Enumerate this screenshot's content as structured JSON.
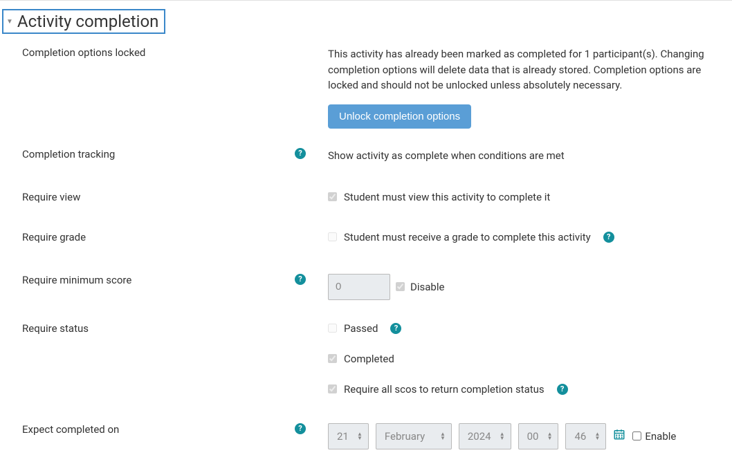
{
  "section": {
    "title": "Activity completion"
  },
  "locked": {
    "label": "Completion options locked",
    "message": "This activity has already been marked as completed for 1 participant(s). Changing completion options will delete data that is already stored. Completion options are locked and should not be unlocked unless absolutely necessary.",
    "button": "Unlock completion options"
  },
  "tracking": {
    "label": "Completion tracking",
    "value": "Show activity as complete when conditions are met"
  },
  "require_view": {
    "label": "Require view",
    "checkbox_label": "Student must view this activity to complete it"
  },
  "require_grade": {
    "label": "Require grade",
    "checkbox_label": "Student must receive a grade to complete this activity"
  },
  "require_min_score": {
    "label": "Require minimum score",
    "value": "0",
    "disable_label": "Disable"
  },
  "require_status": {
    "label": "Require status",
    "passed": "Passed",
    "completed": "Completed",
    "require_all": "Require all scos to return completion status"
  },
  "expect_completed": {
    "label": "Expect completed on",
    "day": "21",
    "month": "February",
    "year": "2024",
    "hour": "00",
    "minute": "46",
    "enable_label": "Enable"
  }
}
